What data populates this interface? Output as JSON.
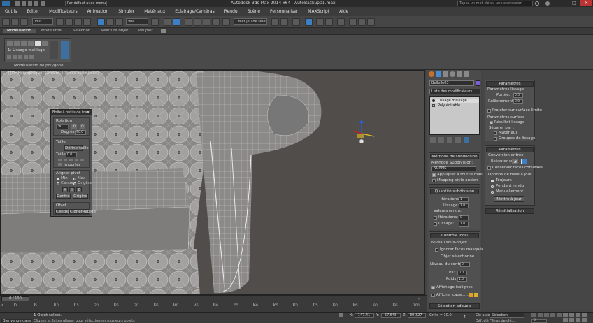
{
  "window": {
    "title": "Autodesk 3ds Max 2014 x64",
    "file": "AutoBackup01.max",
    "workspace": "Par défaut avec menu",
    "search_placeholder": "Tapez un mot-clé ou une expression"
  },
  "menus": [
    "Outils",
    "Editer",
    "Modificateurs",
    "Animation",
    "Simuler",
    "Matériaux",
    "Eclairage/Caméras",
    "Rendu",
    "Scène",
    "Personnaliser",
    "MAXScript",
    "Aide"
  ],
  "toolbar": {
    "selection_filter": "Tout",
    "reference_coord": "Vue",
    "named_selection": "Créer jeu de sélect"
  },
  "ribbon": {
    "tabs": [
      "Modélisation",
      "Mode libre",
      "Sélection",
      "Peinture objet",
      "Peupler"
    ],
    "label_lissage": "1: Lissage maillage",
    "label_poly": "Modélisation de polygone"
  },
  "viewport": {
    "label": "[+] [Orthographique] [Ombré + Faces délimitées]"
  },
  "floater": {
    "title": "Boîte à outils de tran...",
    "rotation_label": "Rotation",
    "rotation_value": "90",
    "degrees_label": "Degrés:",
    "degrees_value": "90.0",
    "size_label": "Taille",
    "set_size_label": "Définir taille",
    "size_field_label": "Taille:",
    "size_value": "0.0",
    "import_label": "Importer",
    "pivot_label": "Aligner pivot",
    "pivot_min": "Min",
    "pivot_max": "Max",
    "pivot_center": "Centre",
    "pivot_origin": "Origine",
    "axes": [
      "X",
      "Y",
      "Z"
    ],
    "center_btn": "Centre",
    "origin_btn": "Origine",
    "object_label": "Objet",
    "object_center": "Centre",
    "clone_label": "ClonerRapide"
  },
  "cmdpanel": {
    "object_name": "Belleile03",
    "modifier_list": "Liste des modificateurs",
    "stack": [
      "Lissage maillage",
      "Poly éditable"
    ],
    "subdiv_method_title": "Méthode de subdivision",
    "subdiv_method_label": "Méthode Subdivision:",
    "subdiv_method_value": "NURMS",
    "apply_whole": "Appliquer à tout le maillage",
    "old_mapping": "Mapping style ancien",
    "subdiv_amount_title": "Quantité subdivision",
    "iterations_label": "Itérations:",
    "iterations_value": "1",
    "smoothness_label": "Lissage:",
    "smoothness_value": "1.0",
    "render_values_label": "Valeurs rendu:",
    "render_iterations": "Itérations:",
    "render_iterations_value": "0",
    "render_smoothness": "Lissage:",
    "render_smoothness_value": "1.0",
    "local_control_title": "Contrôle local",
    "sublevel_label": "Niveau sous-objet:",
    "ignore_backfacing": "Ignorer faces masquées",
    "object_selected": "Objet sélectionné",
    "control_level_label": "Niveau du contrôle:",
    "control_level_value": "0",
    "crease_label": "Pli:",
    "crease_value": "0.0",
    "weight_label": "Poids:",
    "weight_value": "1.0",
    "isoline_display": "Affichage isolignes",
    "show_cage": "Afficher cage......",
    "soft_selection_title": "Sélection adoucie"
  },
  "rightpanel": {
    "params_title": "Paramètres",
    "smoothing_params": "Paramètres lissage",
    "strength_label": "Portée:",
    "strength_value": "0.5",
    "relax_label": "Relâchement:",
    "relax_value": "0.0",
    "project_surface": "Projeter sur surface limite",
    "surface_params": "Paramètres surface",
    "smooth_result": "Résultat lissage",
    "separate_by": "Séparer par :",
    "materials": "Matériaux",
    "smoothing_groups": "Groupes de lissage",
    "params2_title": "Paramètres",
    "input_conversion": "Conversion entrée",
    "run_on": "Exécuter sur:",
    "keep_convex": "Conserver faces convexes",
    "update_options": "Options de mise à jour",
    "always": "Toujours",
    "when_rendering": "Pendant rendu",
    "manually": "Manuellement",
    "update_btn": "Mettre à jour",
    "reset_title": "Réinitialisation"
  },
  "timeline": {
    "frame": "0 / 100",
    "ticks": [
      "0",
      "5",
      "10",
      "15",
      "20",
      "25",
      "30",
      "35",
      "40",
      "45",
      "50",
      "55",
      "60",
      "65",
      "70",
      "75",
      "80",
      "85",
      "90",
      "95",
      "100"
    ]
  },
  "status": {
    "welcome": "Bienvenue dans",
    "selected": "1 Objet sélect.",
    "prompt": "Cliquez et faites glisser pour sélectionner plusieurs objets",
    "x_label": "X:",
    "x_value": "-147.41",
    "y_label": "Y:",
    "y_value": "-67.648",
    "z_label": "Z:",
    "z_value": "30.327",
    "grid": "Grille = 10.0",
    "autokey": "Clé auto",
    "selection": "Sélection",
    "set_key": "Déf. clé",
    "key_filters": "Filtres de clé...",
    "frame_value": "0"
  },
  "colors": {
    "accent": "#3d7fc4",
    "viewport_bg": "#504d4b",
    "panel": "#4b4b4b",
    "swatch_orange": "#e0a020",
    "swatch_yellow": "#d9b030"
  }
}
